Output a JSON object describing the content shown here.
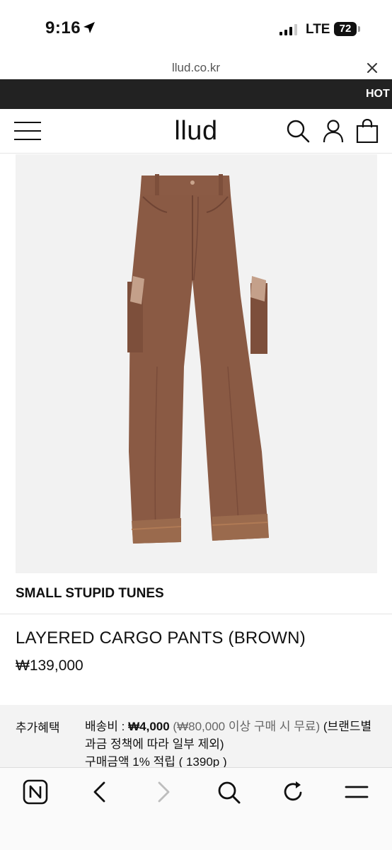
{
  "status_bar": {
    "time": "9:16",
    "network": "LTE",
    "battery": "72"
  },
  "browser": {
    "url": "llud.co.kr"
  },
  "promo": {
    "text": "HOT"
  },
  "header": {
    "logo": "llud"
  },
  "product": {
    "brand": "SMALL STUPID TUNES",
    "name": "LAYERED CARGO PANTS (BROWN)",
    "price": "₩139,000",
    "image": "brown-cargo-pants"
  },
  "benefits": {
    "label": "추가혜택",
    "shipping_label": "배송비 : ",
    "shipping_fee": "₩4,000",
    "shipping_note": "(₩80,000 이상 구매 시 무료)",
    "shipping_policy": " (브랜드별 과금 정책에 따라 일부 제외)",
    "points": "구매금액 1% 적립 ( 1390p )"
  },
  "icons": {
    "close": "close-icon",
    "menu": "hamburger-menu-icon",
    "search": "search-icon",
    "account": "user-icon",
    "cart": "shopping-bag-icon",
    "naver": "naver-n-icon",
    "back": "chevron-left-icon",
    "forward": "chevron-right-icon",
    "browser_search": "search-icon",
    "reload": "reload-icon",
    "tabs": "tabs-menu-icon"
  },
  "colors": {
    "promo_bg": "#222222",
    "pants": "#8a5a44",
    "image_bg": "#f2f2f2",
    "benefit_bg": "#f3f3f3"
  }
}
